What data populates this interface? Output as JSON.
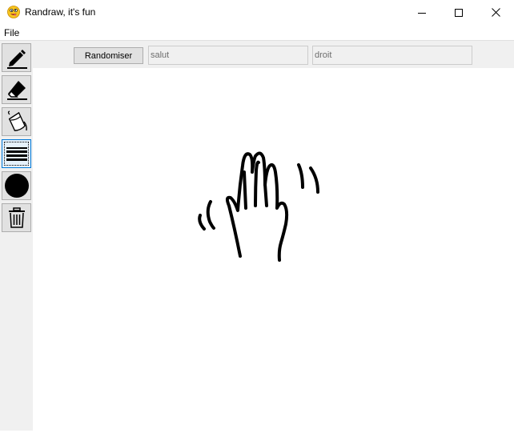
{
  "window": {
    "title": "Randraw, it's fun",
    "app_icon": "emoji-face-icon"
  },
  "menu": {
    "file_label": "File"
  },
  "tools": [
    {
      "name": "pencil",
      "icon": "pencil-icon",
      "selected": false
    },
    {
      "name": "eraser",
      "icon": "eraser-icon",
      "selected": false
    },
    {
      "name": "fill",
      "icon": "paint-bucket-icon",
      "selected": false
    },
    {
      "name": "line-width",
      "icon": "line-width-icon",
      "selected": true
    },
    {
      "name": "color",
      "icon": "color-circle-icon",
      "selected": false
    },
    {
      "name": "clear",
      "icon": "trash-icon",
      "selected": false
    }
  ],
  "toolbar": {
    "randomize_label": "Randomiser",
    "field1_value": "salut",
    "field2_value": "droit"
  },
  "colors": {
    "current_brush": "#000000",
    "selected_border": "#0078d7"
  }
}
